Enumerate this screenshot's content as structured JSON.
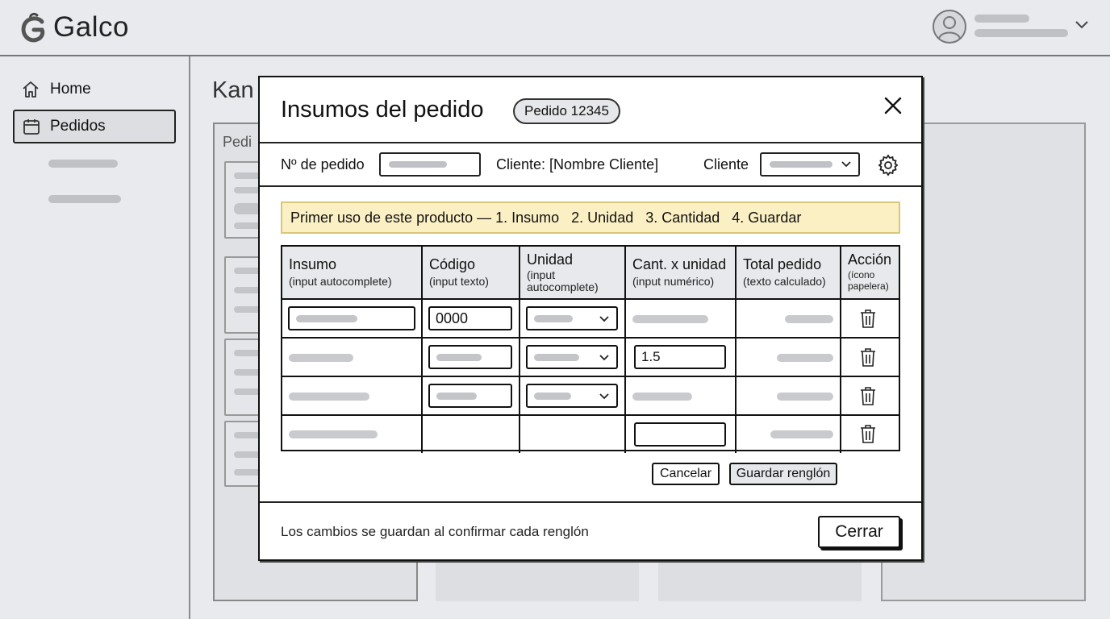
{
  "app": {
    "name": "Galco"
  },
  "sidebar": {
    "items": [
      {
        "label": "Home",
        "icon": "home-icon"
      },
      {
        "label": "Pedidos",
        "icon": "calendar-icon"
      }
    ]
  },
  "board": {
    "title": "Kan",
    "column_label": "Pedi"
  },
  "modal": {
    "title": "Insumos del pedido",
    "badge": "Pedido 12345",
    "filters": {
      "order_label": "Nº de pedido",
      "client_text": "Cliente: [Nombre Cliente]",
      "client_label": "Cliente"
    },
    "banner": "Primer uso de este producto — 1. Insumo   2. Unidad   3. Cantidad   4. Guardar",
    "table": {
      "headers": [
        {
          "main": "Insumo",
          "sub": "(input autocomplete)"
        },
        {
          "main": "Código",
          "sub": "(input texto)"
        },
        {
          "main": "Unidad",
          "sub": "(input autocomplete)"
        },
        {
          "main": "Cant. x unidad",
          "sub": "(input numérico)"
        },
        {
          "main": "Total pedido",
          "sub": "(texto calculado)"
        },
        {
          "main": "Acción",
          "sub": "(ícono papelera)"
        }
      ],
      "row1_code": "0000",
      "row2_qty": "1.5"
    },
    "buttons": {
      "cancel": "Cancelar",
      "save_row": "Guardar renglón",
      "close": "Cerrar"
    },
    "footer_note": "Los cambios se guardan al confirmar cada renglón"
  },
  "colors": {
    "banner_bg": "#fbf0c4",
    "border": "#111111",
    "placeholder": "#c3c5c9"
  }
}
